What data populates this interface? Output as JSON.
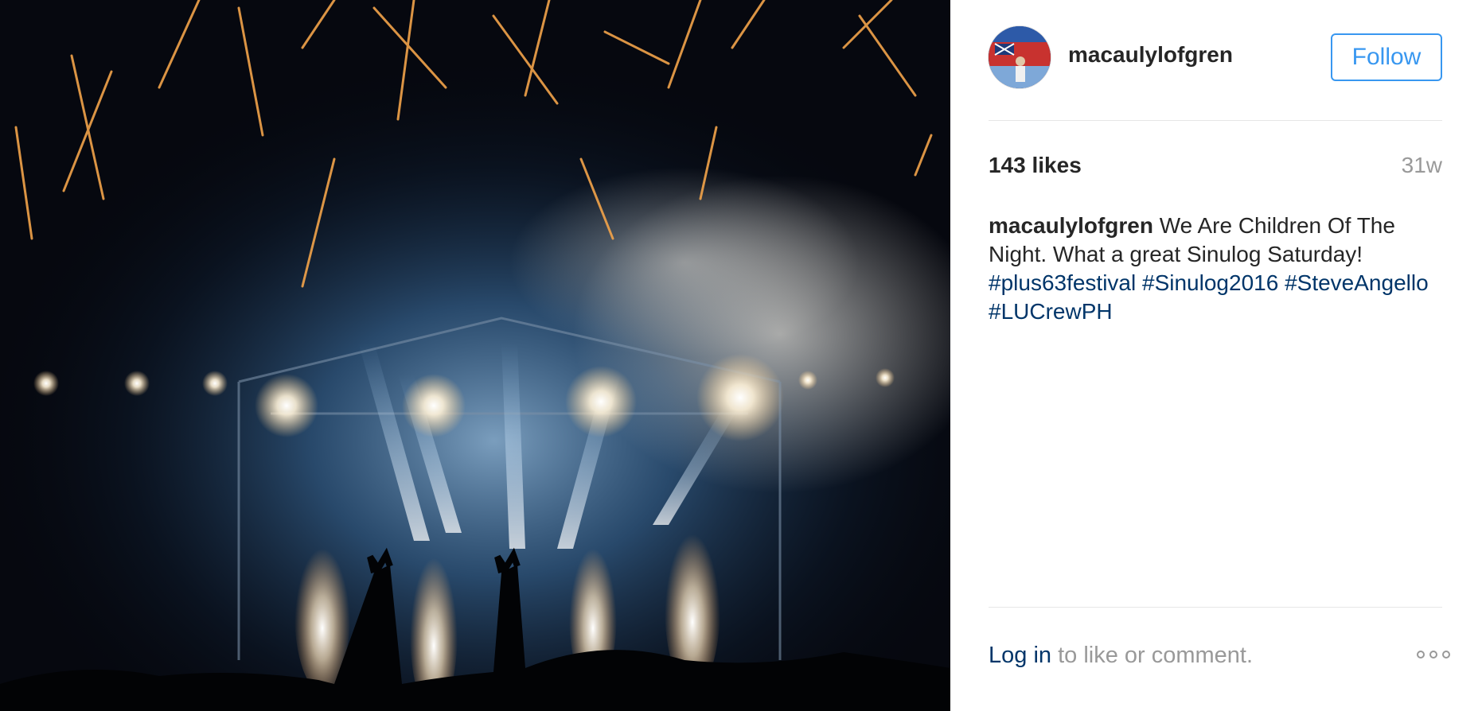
{
  "post": {
    "image_alt": "Concert stage with fireworks and blue stage lights",
    "author": {
      "username": "macaulylofgren",
      "avatar": "profile-avatar"
    },
    "follow_label": "Follow",
    "likes_text": "143 likes",
    "age": "31w",
    "caption": {
      "username": "macaulylofgren",
      "text": "We Are Children Of The Night. What a great Sinulog Saturday!",
      "hashtags": [
        "#plus63festival",
        "#Sinulog2016",
        "#SteveAngello",
        "#LUCrewPH"
      ]
    },
    "footer": {
      "login_link": "Log in",
      "login_rest": "to like or comment.",
      "more_icon": "more-options-icon"
    }
  },
  "colors": {
    "accent_blue": "#3897f0",
    "link_dark_blue": "#003569",
    "muted_gray": "#999999",
    "text": "#262626"
  }
}
